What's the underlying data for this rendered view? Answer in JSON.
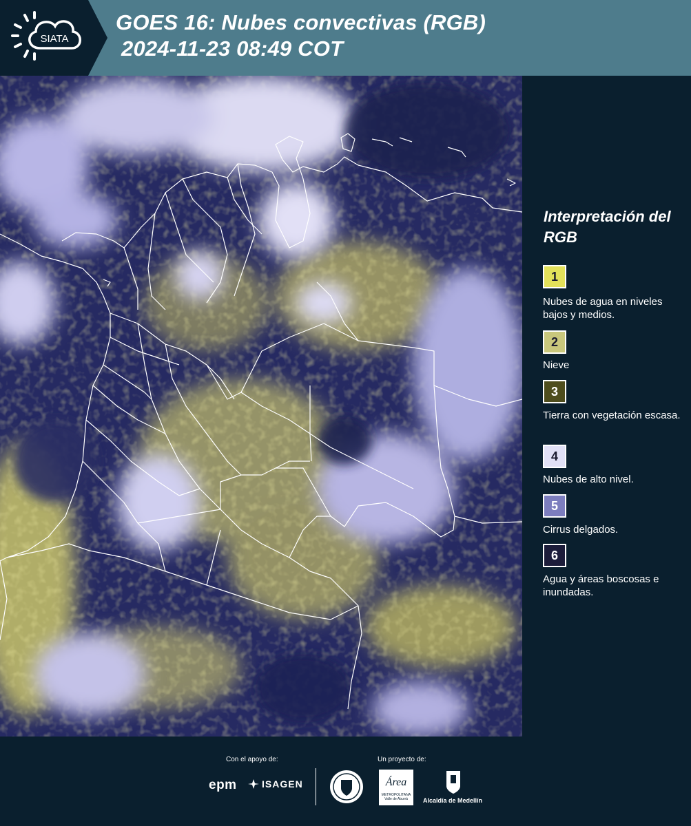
{
  "header": {
    "logo_text": "SIATA",
    "title_line1": "GOES 16: Nubes convectivas (RGB)",
    "title_line2": "2024-11-23 08:49 COT"
  },
  "legend": {
    "title": "Interpretación del RGB",
    "items": [
      {
        "number": "1",
        "label": "Nubes de agua en niveles bajos y medios.",
        "color": "#e3e15a"
      },
      {
        "number": "2",
        "label": "Nieve",
        "color": "#c9c77c"
      },
      {
        "number": "3",
        "label": "Tierra con vegetación escasa.",
        "color": "#4e4d1d"
      },
      {
        "number": "4",
        "label": "Nubes de alto nivel.",
        "color": "#e1e0f6"
      },
      {
        "number": "5",
        "label": "Cirrus delgados.",
        "color": "#7c7dbe"
      },
      {
        "number": "6",
        "label": "Agua y áreas boscosas e inundadas.",
        "color": "#1c1c3a"
      }
    ]
  },
  "footer": {
    "support_label": "Con el apoyo de:",
    "project_label": "Un proyecto de:",
    "sponsor_epm": "epm",
    "sponsor_isagen": "ISAGEN",
    "partner_area": "Área",
    "partner_area_sub": "METROPOLITANA Valle de Aburrá",
    "partner_alcaldia": "Alcaldía de Medellín"
  }
}
